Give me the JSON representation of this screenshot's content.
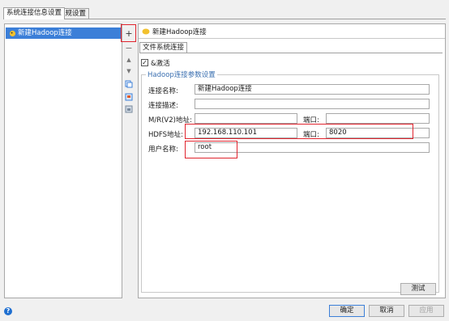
{
  "tabs": [
    "系统连接信息设置",
    "常规设置"
  ],
  "connections": [
    "新建Hadoop连接"
  ],
  "toolbar": {
    "add": "+",
    "remove": "−",
    "up": "▲",
    "down": "▼"
  },
  "detail": {
    "title": "新建Hadoop连接",
    "subtab": "文件系统连接",
    "enable_label": "&激活",
    "enable_checked": true,
    "group_title": "Hadoop连接参数设置",
    "fields": {
      "name_label": "连接名称:",
      "name_value": "新建Hadoop连接",
      "desc_label": "连接描述:",
      "desc_value": "",
      "mr_label": "M/R(V2)地址:",
      "mr_value": "",
      "mr_port_label": "端口:",
      "mr_port_value": "",
      "hdfs_label": "HDFS地址:",
      "hdfs_value": "192.168.110.101",
      "hdfs_port_label": "端口:",
      "hdfs_port_value": "8020",
      "user_label": "用户名称:",
      "user_value": "root"
    },
    "test_button": "测试"
  },
  "footer": {
    "ok": "确定",
    "cancel": "取消",
    "apply": "应用",
    "help": "?"
  },
  "colors": {
    "selection": "#3c7fd8",
    "highlight": "#e0242e",
    "group_title": "#3a6fb0"
  }
}
